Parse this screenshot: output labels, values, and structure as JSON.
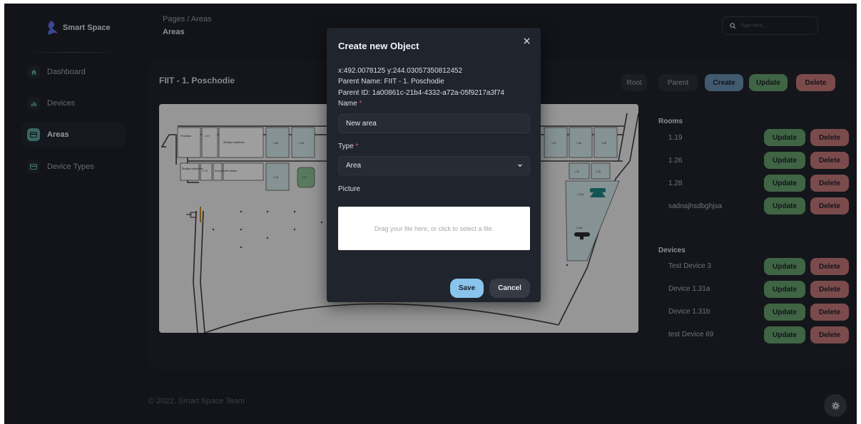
{
  "app": {
    "name": "Smart Space"
  },
  "sidebar": {
    "items": [
      {
        "label": "Dashboard",
        "icon": "home-icon"
      },
      {
        "label": "Devices",
        "icon": "bar-chart-icon"
      },
      {
        "label": "Areas",
        "icon": "card-icon",
        "active": true
      },
      {
        "label": "Device Types",
        "icon": "card-icon"
      }
    ]
  },
  "header": {
    "breadcrumb": "Pages / Areas",
    "title": "Areas",
    "search_placeholder": "Type here..."
  },
  "main": {
    "area_title": "FIIT - 1. Poschodie",
    "toolbar": {
      "root": "Root",
      "parent": "Parent",
      "create": "Create",
      "update": "Update",
      "delete": "Delete"
    },
    "rooms_heading": "Rooms",
    "rooms": [
      "1.19",
      "1.26",
      "1.28",
      "sadnajhsdbghjsa"
    ],
    "devices_heading": "Devices",
    "devices": [
      "Test Device 3",
      "Device 1.31a",
      "Device 1.31b",
      "test Device 69"
    ],
    "row_update": "Update",
    "row_delete": "Delete"
  },
  "floorplan": {
    "labels": {
      "prodekan": "Prodekan",
      "r107": "1.07",
      "studijne": "Študijné oddelenie",
      "r105": "1.05",
      "r104": "1.04",
      "r137": "1.37",
      "r136": "1.36",
      "r135": "1.35",
      "studijne_dl": "Študijné oddelenie",
      "r113": "1.13",
      "kuchyna": "Kuchynka",
      "prodekan2": "Prodekan",
      "r118": "1.18",
      "r119": "1.19",
      "r132": "1.32",
      "r133": "1.33",
      "r131a": "1.31a",
      "r131b": "1.31b"
    }
  },
  "modal": {
    "title": "Create new Object",
    "coords": "x:492.0078125 y:244.03057350812452",
    "parent_name": "Parent Name: FIIT - 1. Poschodie",
    "parent_id": "Parent ID: 1a00861c-21b4-4332-a72a-05f9217a3f74",
    "name_label": "Name",
    "name_value": "New area",
    "type_label": "Type",
    "type_value": "Area",
    "picture_label": "Picture",
    "dropzone_text": "Drag your file here, or click to select a file.",
    "save": "Save",
    "cancel": "Cancel",
    "required_mark": "*"
  },
  "footer": {
    "text": "© 2022, Smart Space Team"
  },
  "colors": {
    "background": "#1d2129",
    "accent_teal": "#59a89e",
    "create": "#6a92b4",
    "update": "#67a46f",
    "delete": "#c77a7b",
    "save": "#8ac4ec"
  }
}
